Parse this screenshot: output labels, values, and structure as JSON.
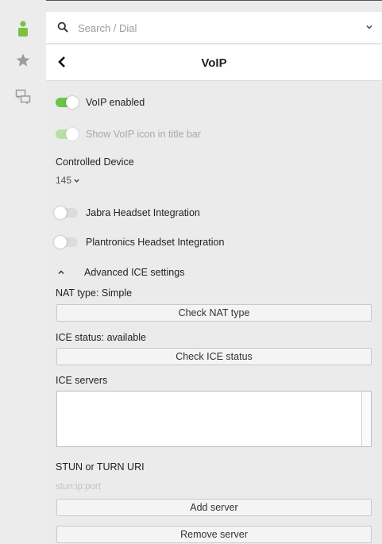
{
  "sidebar": {
    "items": [
      {
        "name": "contacts",
        "icon": "person-icon",
        "active": true
      },
      {
        "name": "favorites",
        "icon": "star-icon"
      },
      {
        "name": "chats",
        "icon": "chat-bubbles-icon"
      }
    ]
  },
  "search": {
    "placeholder": "Search / Dial",
    "value": ""
  },
  "header": {
    "title": "VoIP"
  },
  "settings": {
    "voip_enabled": {
      "label": "VoIP enabled",
      "on": true
    },
    "show_icon": {
      "label": "Show VoIP icon in title bar",
      "on": true,
      "disabled": true
    },
    "controlled_device": {
      "label": "Controlled Device",
      "value": "145"
    },
    "jabra": {
      "label": "Jabra Headset Integration",
      "on": false
    },
    "plantronics": {
      "label": "Plantronics Headset Integration",
      "on": false
    },
    "advanced": {
      "label": "Advanced ICE settings",
      "expanded": true
    },
    "nat_type": {
      "label": "NAT type: Simple",
      "button": "Check NAT type"
    },
    "ice_status": {
      "label": "ICE status: available",
      "button": "Check ICE status"
    },
    "ice_servers": {
      "label": "ICE servers",
      "value": ""
    },
    "stun_uri": {
      "label": "STUN or TURN URI",
      "placeholder": "stun:ip:port",
      "value": ""
    },
    "add_server": "Add server",
    "remove_server": "Remove server"
  },
  "colors": {
    "accent_green": "#6cc24a",
    "panel_bg": "#ebebeb",
    "sidebar_bg": "#ececec"
  }
}
